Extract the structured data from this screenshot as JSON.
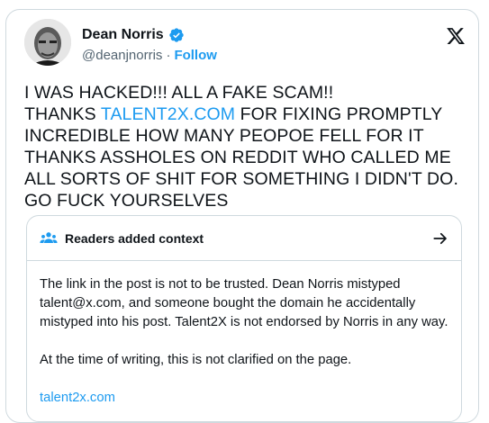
{
  "author": {
    "name": "Dean Norris",
    "handle": "@deanjnorris",
    "separator": "·",
    "follow_label": "Follow"
  },
  "tweet": {
    "line1": "I WAS HACKED!!! ALL A FAKE SCAM!!",
    "line2_prefix": "THANKS ",
    "line2_link": "TALENT2X.COM",
    "line2_suffix": " FOR FIXING PROMPTLY",
    "line3": "INCREDIBLE HOW MANY PEOPOE FELL FOR IT",
    "line4": "THANKS ASSHOLES ON REDDIT WHO CALLED ME ALL SORTS OF SHIT FOR SOMETHING I DIDN'T DO. GO FUCK YOURSELVES"
  },
  "community_note": {
    "title": "Readers added context",
    "paragraph1": "The link in the post is not to be trusted. Dean Norris mistyped talent@x.com, and someone bought the domain he accidentally mistyped into his post. Talent2X is not endorsed by Norris in any way.",
    "paragraph2": "At the time of writing, this is not clarified on the page.",
    "link": "talent2x.com"
  },
  "icons": {
    "verified": "verified-badge-icon",
    "platform": "x-logo-icon",
    "note": "people-icon",
    "open": "arrow-right-icon"
  },
  "colors": {
    "link_blue": "#1d9bf0",
    "text": "#0f1419",
    "muted": "#536471",
    "border": "#cfd9de"
  }
}
